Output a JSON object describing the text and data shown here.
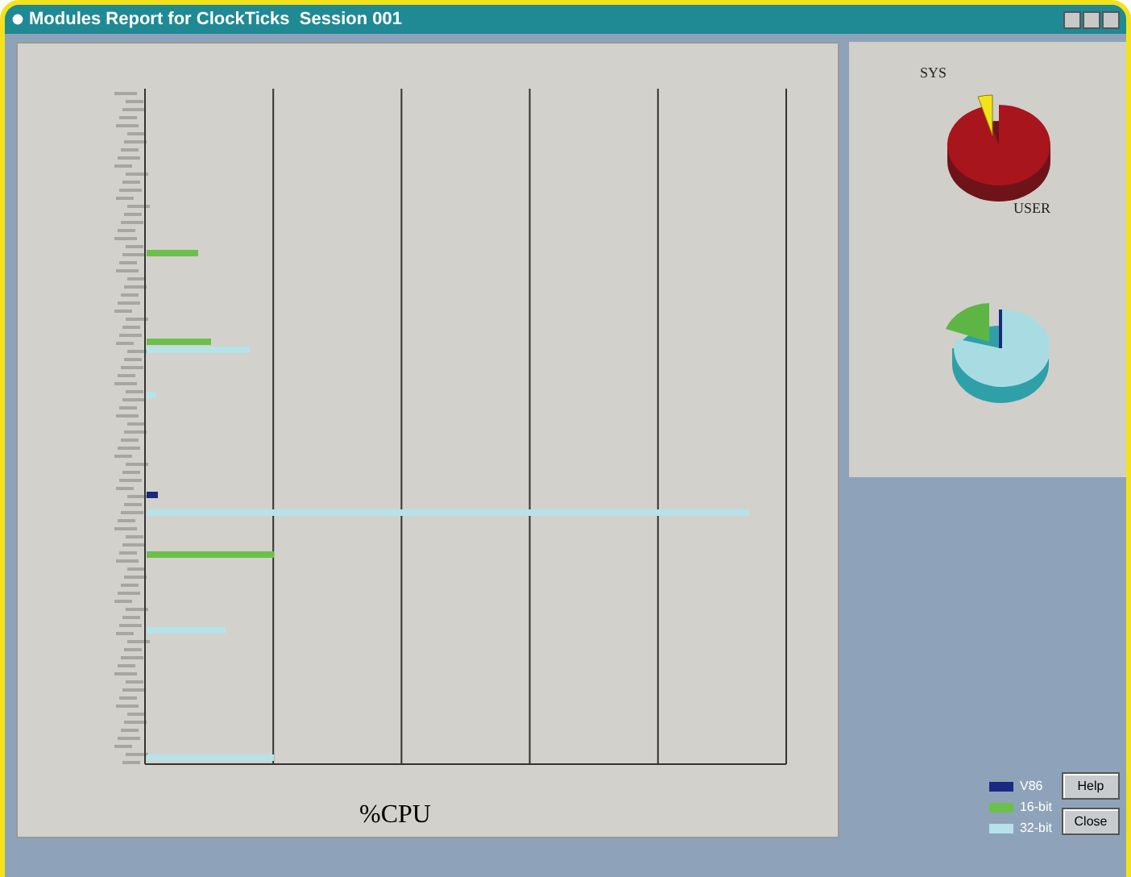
{
  "window": {
    "title": "Modules Report for ClockTicks  Session 001"
  },
  "chart": {
    "xlabel": "%CPU"
  },
  "pie": {
    "labels": [
      {
        "text": "SYS"
      },
      {
        "text": "USER"
      }
    ]
  },
  "legend": [
    {
      "label": "V86",
      "color": "#1a2a80"
    },
    {
      "label": "16-bit",
      "color": "#6cbf4a"
    },
    {
      "label": "32-bit",
      "color": "#b6e2ea"
    }
  ],
  "buttons": [
    "Help",
    "Close"
  ]
}
